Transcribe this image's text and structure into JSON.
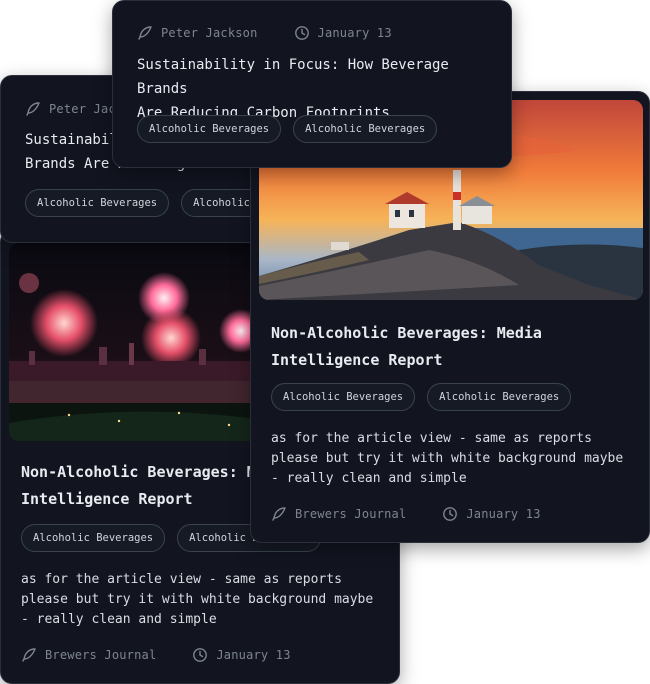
{
  "cards": {
    "back_left": {
      "author": "Peter Jackson",
      "title": "Sustainability in Focus: How Beverage Brands Are Reducing Carbon Footprints",
      "tags": [
        "Alcoholic Beverages",
        "Alcoholic Beverages"
      ]
    },
    "top": {
      "author": "Peter Jackson",
      "date": "January 13",
      "title_line1": "Sustainability in Focus: How Beverage Brands",
      "title_line2": "Are Reducing Carbon Footprints",
      "tags": [
        "Alcoholic Beverages",
        "Alcoholic Beverages"
      ]
    },
    "fireworks": {
      "title_line1": "Non-Alcoholic Beverages: Media",
      "title_line2": "Intelligence Report",
      "tags": [
        "Alcoholic Beverages",
        "Alcoholic Beverages"
      ],
      "desc_line1": "as for the article view - same as reports",
      "desc_line2": "please but try it with white background maybe",
      "desc_line3": "- really clean and simple",
      "source": "Brewers Journal",
      "date": "January 13"
    },
    "lighthouse": {
      "title_line1": "Non-Alcoholic Beverages: Media",
      "title_line2": "Intelligence Report",
      "tags": [
        "Alcoholic Beverages",
        "Alcoholic Beverages"
      ],
      "desc_line1": "as for the article view - same as reports",
      "desc_line2": "please but try it with white background maybe",
      "desc_line3": "- really clean and simple",
      "source": "Brewers Journal",
      "date": "January 13"
    }
  },
  "icons": {
    "author": "feather-icon",
    "date": "clock-icon"
  }
}
